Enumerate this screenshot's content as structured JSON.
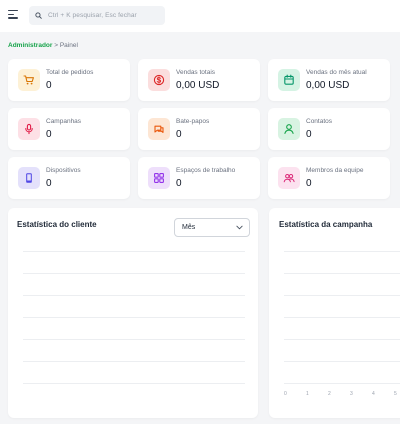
{
  "header": {
    "search_placeholder": "Ctrl + K pesquisar, Esc fechar"
  },
  "breadcrumb": {
    "root": "Administrador",
    "separator": ">",
    "current": "Painel"
  },
  "stats": [
    {
      "label": "Total de pedidos",
      "value": "0",
      "icon": "cart-icon",
      "bg": "#fdf1d6",
      "color": "#d97706"
    },
    {
      "label": "Vendas totais",
      "value": "0,00 USD",
      "icon": "dollar-icon",
      "bg": "#fbdede",
      "color": "#dc2626"
    },
    {
      "label": "Vendas do mês atual",
      "value": "0,00 USD",
      "icon": "calendar-icon",
      "bg": "#d5f3e4",
      "color": "#059669"
    },
    {
      "label": "Campanhas",
      "value": "0",
      "icon": "microphone-icon",
      "bg": "#fde0e6",
      "color": "#e11d48"
    },
    {
      "label": "Bate-papos",
      "value": "0",
      "icon": "chat-icon",
      "bg": "#fde6d4",
      "color": "#ea580c"
    },
    {
      "label": "Contatos",
      "value": "0",
      "icon": "user-icon",
      "bg": "#d8f3e2",
      "color": "#16a34a"
    },
    {
      "label": "Dispositivos",
      "value": "0",
      "icon": "device-icon",
      "bg": "#e4e1fb",
      "color": "#4f46e5"
    },
    {
      "label": "Espaços de trabalho",
      "value": "0",
      "icon": "grid-icon",
      "bg": "#eedffb",
      "color": "#9333ea"
    },
    {
      "label": "Membros da equipe",
      "value": "0",
      "icon": "team-icon",
      "bg": "#fce2ef",
      "color": "#db2777"
    }
  ],
  "client_stats": {
    "title": "Estatística do cliente",
    "period": "Mês"
  },
  "campaign_stats": {
    "title": "Estatística da campanha",
    "x_ticks": [
      "0",
      "1",
      "2",
      "3",
      "4",
      "5"
    ]
  }
}
